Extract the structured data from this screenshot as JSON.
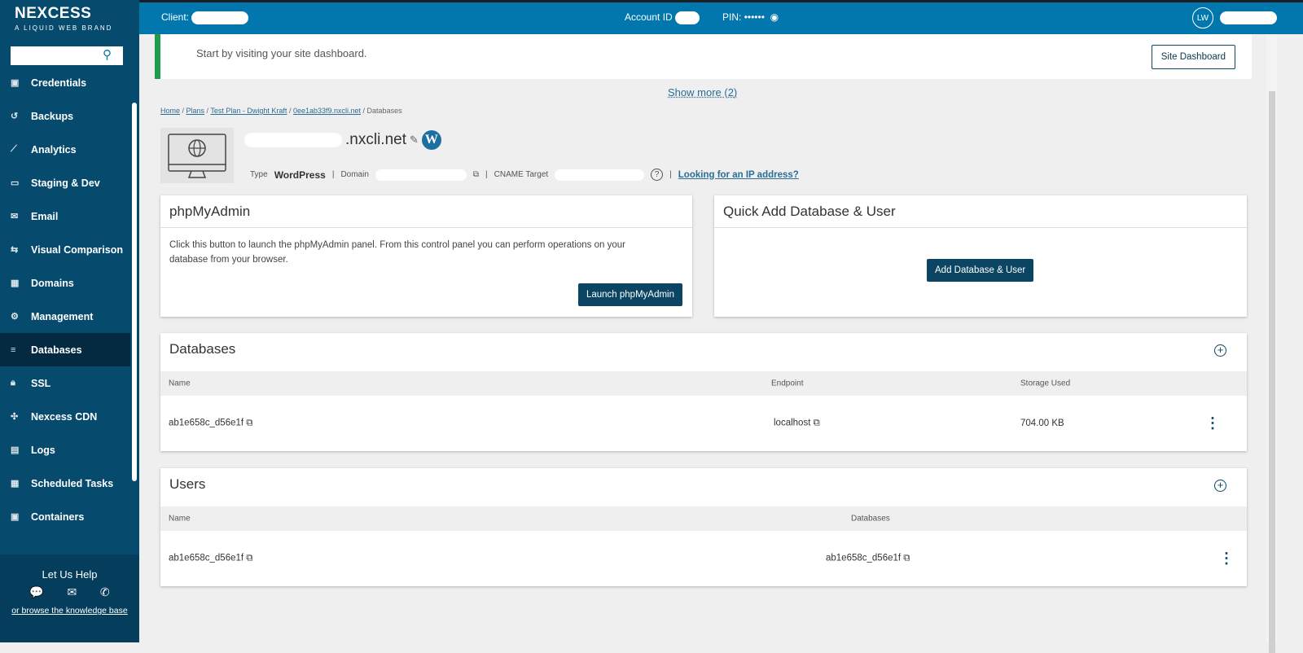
{
  "brand": {
    "name": "NEXCESS",
    "tagline": "A LIQUID WEB BRAND"
  },
  "sidebar": {
    "items": [
      {
        "label": "Credentials",
        "icon": "id-card-icon"
      },
      {
        "label": "Backups",
        "icon": "history-icon"
      },
      {
        "label": "Analytics",
        "icon": "chart-icon"
      },
      {
        "label": "Staging & Dev",
        "icon": "monitor-icon"
      },
      {
        "label": "Email",
        "icon": "mail-icon"
      },
      {
        "label": "Visual Comparison",
        "icon": "compare-icon"
      },
      {
        "label": "Domains",
        "icon": "domain-icon"
      },
      {
        "label": "Management",
        "icon": "gear-icon"
      },
      {
        "label": "Databases",
        "icon": "database-icon",
        "active": true
      },
      {
        "label": "SSL",
        "icon": "lock-icon"
      },
      {
        "label": "Nexcess CDN",
        "icon": "cdn-icon"
      },
      {
        "label": "Logs",
        "icon": "log-icon"
      },
      {
        "label": "Scheduled Tasks",
        "icon": "calendar-icon"
      },
      {
        "label": "Containers",
        "icon": "container-icon"
      }
    ],
    "help_title": "Let Us Help",
    "help_link": "or browse the knowledge base"
  },
  "topbar": {
    "client_label": "Client:",
    "account_label": "Account ID",
    "pin_label": "PIN:",
    "pin_value": "••••••",
    "user_initials": "LW"
  },
  "banner": {
    "text": "Start by visiting your site dashboard.",
    "button": "Site Dashboard"
  },
  "show_more": "Show more (2)",
  "breadcrumb": [
    "Home",
    "Plans",
    "Test Plan - Dwight Kraft",
    "0ee1ab33f9.nxcli.net",
    "Databases"
  ],
  "site": {
    "name_suffix": ".nxcli.net",
    "type_label": "Type",
    "type_value": "WordPress",
    "domain_label": "Domain",
    "cname_label": "CNAME Target",
    "ip_link": "Looking for an IP address?"
  },
  "phpmyadmin": {
    "title": "phpMyAdmin",
    "description": "Click this button to launch the phpMyAdmin panel. From this control panel you can perform operations on your database from your browser.",
    "button": "Launch phpMyAdmin"
  },
  "quick_add": {
    "title": "Quick Add Database & User",
    "button": "Add Database & User"
  },
  "databases": {
    "title": "Databases",
    "columns": [
      "Name",
      "Endpoint",
      "Storage Used"
    ],
    "rows": [
      {
        "name": "ab1e658c_d56e1f",
        "endpoint": "localhost",
        "storage": "704.00 KB"
      }
    ]
  },
  "users": {
    "title": "Users",
    "columns": [
      "Name",
      "Databases"
    ],
    "rows": [
      {
        "name": "ab1e658c_d56e1f",
        "databases": "ab1e658c_d56e1f"
      }
    ]
  },
  "colors": {
    "sidebar": "#064a6e",
    "topbar": "#0277ad",
    "accent_green": "#1e9b4f",
    "button_dark": "#0b4563"
  }
}
